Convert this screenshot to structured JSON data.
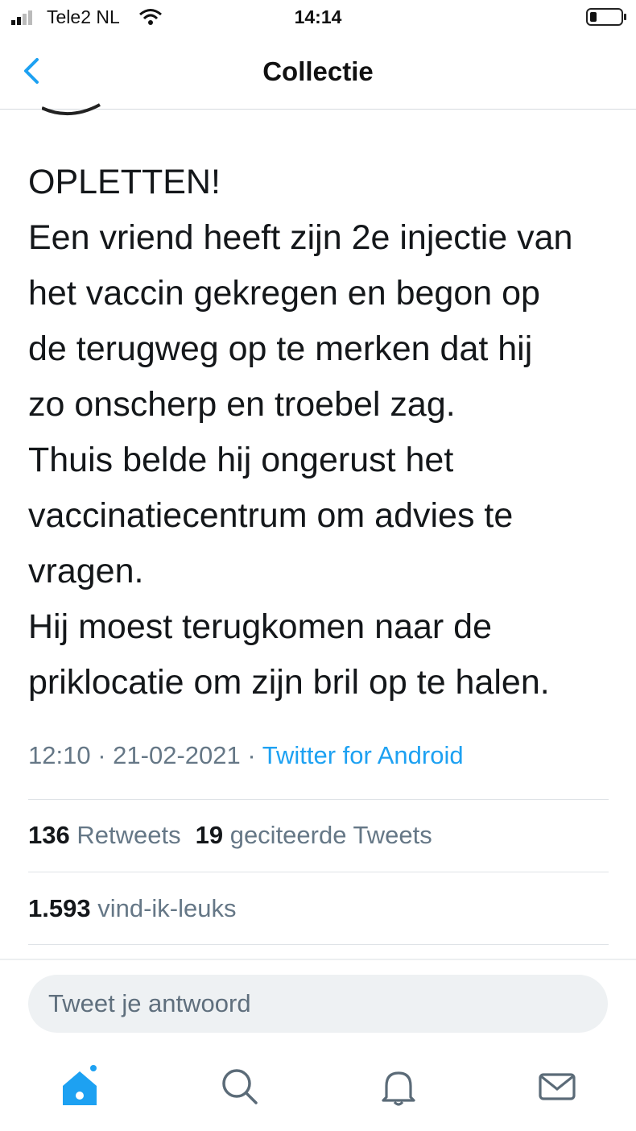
{
  "status_bar": {
    "carrier": "Tele2 NL",
    "time": "14:14"
  },
  "nav": {
    "title": "Collectie"
  },
  "tweet": {
    "lines": [
      "OPLETTEN!",
      "Een vriend heeft zijn 2e injectie van",
      "het vaccin gekregen en begon op",
      "de terugweg op te merken dat hij",
      "zo onscherp en troebel zag.",
      "Thuis belde hij ongerust het",
      "vaccinatiecentrum om advies te",
      "vragen.",
      "Hij moest terugkomen naar de",
      "priklocatie om zijn bril op te halen."
    ],
    "time": "12:10",
    "date": "21-02-2021",
    "separator": "·",
    "source": "Twitter for Android"
  },
  "stats": {
    "retweets_count": "136",
    "retweets_label": "Retweets",
    "quotes_count": "19",
    "quotes_label": "geciteerde Tweets",
    "likes_count": "1.593",
    "likes_label": "vind-ik-leuks"
  },
  "reply": {
    "placeholder": "Tweet je antwoord"
  },
  "tab_bar": {
    "icons": [
      "home-icon",
      "search-icon",
      "bell-icon",
      "mail-icon"
    ]
  },
  "colors": {
    "accent": "#1da1f2",
    "secondary_text": "#657786",
    "primary_text": "#14171a",
    "reply_bg": "#eef1f3"
  }
}
